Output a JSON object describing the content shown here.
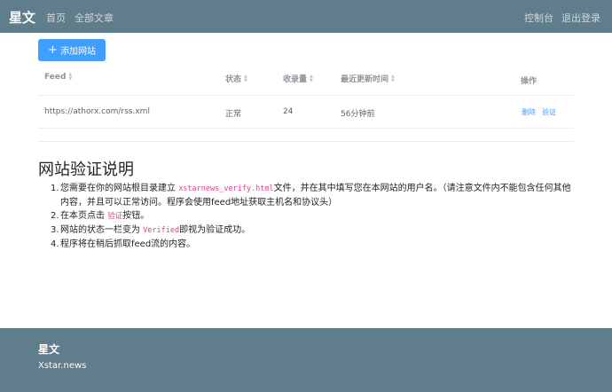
{
  "nav": {
    "brand": "星文",
    "home": "首页",
    "all_articles": "全部文章",
    "console": "控制台",
    "logout": "退出登录"
  },
  "toolbar": {
    "add_site": "添加网站"
  },
  "table": {
    "headers": {
      "feed": "Feed",
      "status": "状态",
      "count": "收录量",
      "updated": "最近更新时间",
      "ops": "操作"
    },
    "rows": [
      {
        "feed": "https://athorx.com/rss.xml",
        "status": "正常",
        "count": "24",
        "updated": "56分钟前",
        "delete": "删除",
        "verify": "验证"
      }
    ]
  },
  "guide": {
    "title": "网站验证说明",
    "steps": [
      {
        "num": "1.",
        "pre": "您需要在你的网站根目录建立 ",
        "code": "xstarnews_verify.html",
        "post": "文件，并在其中填写您在本网站的用户名。（请注意文件内不能包含任何其他内容，并且可以正常访问。程序会使用feed地址获取主机名和协议头）"
      },
      {
        "num": "2.",
        "pre": "在本页点击 ",
        "code": "验证",
        "post": "按钮。"
      },
      {
        "num": "3.",
        "pre": "网站的状态一栏变为 ",
        "code": "Verified",
        "post": "即视为验证成功。"
      },
      {
        "num": "4.",
        "pre": "程序将在稍后抓取feed流的内容。",
        "code": "",
        "post": ""
      }
    ]
  },
  "footer": {
    "title": "星文",
    "site": "Xstar.news"
  },
  "colors": {
    "nav_bg": "#607d8b",
    "primary": "#409eff",
    "code": "#e83e8c"
  }
}
